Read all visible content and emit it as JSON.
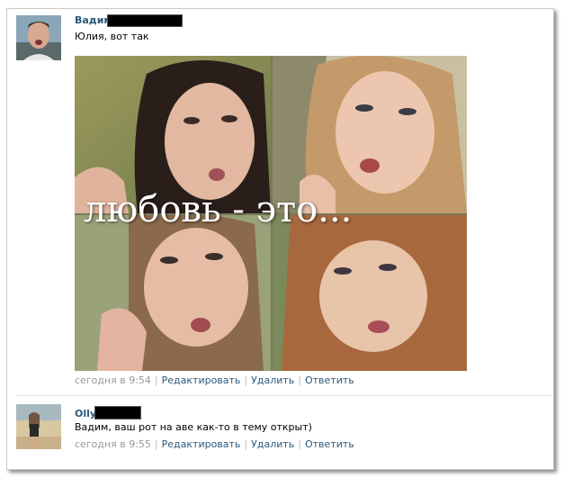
{
  "post": {
    "author": "Вадим",
    "text": "Юлия, вот так",
    "image_caption": "любовь - это...",
    "time": "сегодня в 9:54",
    "actions": [
      "Редактировать",
      "Удалить",
      "Ответить"
    ]
  },
  "reply": {
    "author": "Olly",
    "text": "Вадим, ваш рот на аве как-то в тему открыт)",
    "time": "сегодня в 9:55",
    "actions": [
      "Редактировать",
      "Удалить",
      "Ответить"
    ]
  },
  "colors": {
    "link": "#2b587a",
    "meta": "#999999",
    "divider": "#dae1e8"
  }
}
